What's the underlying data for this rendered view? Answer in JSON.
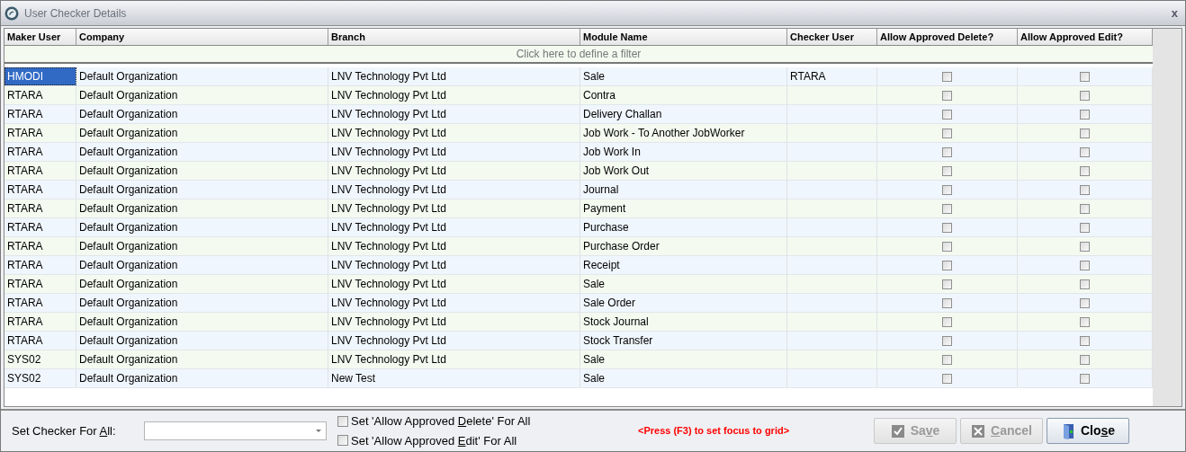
{
  "window": {
    "title": "User Checker Details",
    "close": "x"
  },
  "table": {
    "columns": [
      "Maker User",
      "Company",
      "Branch",
      "Module Name",
      "Checker User",
      "Allow Approved Delete?",
      "Allow Approved Edit?"
    ],
    "filter_hint": "Click here to define a filter",
    "rows": [
      {
        "maker": "HMODI",
        "company": "Default Organization",
        "branch": "LNV Technology Pvt Ltd",
        "module": "Sale",
        "checker": "RTARA",
        "delete": false,
        "edit": false,
        "selected": true
      },
      {
        "maker": "RTARA",
        "company": "Default Organization",
        "branch": "LNV Technology Pvt Ltd",
        "module": "Contra",
        "delete": false,
        "edit": false,
        "selected": false
      },
      {
        "maker": "RTARA",
        "company": "Default Organization",
        "branch": "LNV Technology Pvt Ltd",
        "module": "Delivery Challan",
        "delete": false,
        "edit": false,
        "selected": false
      },
      {
        "maker": "RTARA",
        "company": "Default Organization",
        "branch": "LNV Technology Pvt Ltd",
        "module": "Job Work - To Another JobWorker",
        "delete": false,
        "edit": false,
        "selected": false
      },
      {
        "maker": "RTARA",
        "company": "Default Organization",
        "branch": "LNV Technology Pvt Ltd",
        "module": "Job Work In",
        "delete": false,
        "edit": false,
        "selected": false
      },
      {
        "maker": "RTARA",
        "company": "Default Organization",
        "branch": "LNV Technology Pvt Ltd",
        "module": "Job Work Out",
        "delete": false,
        "edit": false,
        "selected": false
      },
      {
        "maker": "RTARA",
        "company": "Default Organization",
        "branch": "LNV Technology Pvt Ltd",
        "module": "Journal",
        "delete": false,
        "edit": false,
        "selected": false
      },
      {
        "maker": "RTARA",
        "company": "Default Organization",
        "branch": "LNV Technology Pvt Ltd",
        "module": "Payment",
        "delete": false,
        "edit": false,
        "selected": false
      },
      {
        "maker": "RTARA",
        "company": "Default Organization",
        "branch": "LNV Technology Pvt Ltd",
        "module": "Purchase",
        "delete": false,
        "edit": false,
        "selected": false
      },
      {
        "maker": "RTARA",
        "company": "Default Organization",
        "branch": "LNV Technology Pvt Ltd",
        "module": "Purchase Order",
        "delete": false,
        "edit": false,
        "selected": false
      },
      {
        "maker": "RTARA",
        "company": "Default Organization",
        "branch": "LNV Technology Pvt Ltd",
        "module": "Receipt",
        "delete": false,
        "edit": false,
        "selected": false
      },
      {
        "maker": "RTARA",
        "company": "Default Organization",
        "branch": "LNV Technology Pvt Ltd",
        "module": "Sale",
        "delete": false,
        "edit": false,
        "selected": false
      },
      {
        "maker": "RTARA",
        "company": "Default Organization",
        "branch": "LNV Technology Pvt Ltd",
        "module": "Sale Order",
        "delete": false,
        "edit": false,
        "selected": false
      },
      {
        "maker": "RTARA",
        "company": "Default Organization",
        "branch": "LNV Technology Pvt Ltd",
        "module": "Stock Journal",
        "delete": false,
        "edit": false,
        "selected": false
      },
      {
        "maker": "RTARA",
        "company": "Default Organization",
        "branch": "LNV Technology Pvt Ltd",
        "module": "Stock Transfer",
        "delete": false,
        "edit": false,
        "selected": false
      },
      {
        "maker": "SYS02",
        "company": "Default Organization",
        "branch": "LNV Technology Pvt Ltd",
        "module": "Sale",
        "delete": false,
        "edit": false,
        "selected": false
      },
      {
        "maker": "SYS02",
        "company": "Default Organization",
        "branch": "New Test",
        "module": "Sale",
        "delete": false,
        "edit": false,
        "selected": false
      }
    ]
  },
  "footer": {
    "checker_label": {
      "before": "Set Checker For ",
      "key": "A",
      "after": "ll:"
    },
    "options": [
      {
        "before": "Set 'Allow Approved ",
        "key": "D",
        "after": "elete' For All",
        "checked": false
      },
      {
        "before": "Set 'Allow Approved ",
        "key": "E",
        "after": "dit' For All",
        "checked": false
      }
    ],
    "hint": "<Press (F3) to set focus to grid>",
    "buttons": [
      {
        "kind": "save",
        "before": "Sa",
        "key": "v",
        "after": "e",
        "disabled": true
      },
      {
        "kind": "cancel",
        "key": "C",
        "after": "ancel",
        "disabled": true
      },
      {
        "kind": "close",
        "before": "Clo",
        "key": "s",
        "after": "e",
        "disabled": false
      }
    ]
  }
}
